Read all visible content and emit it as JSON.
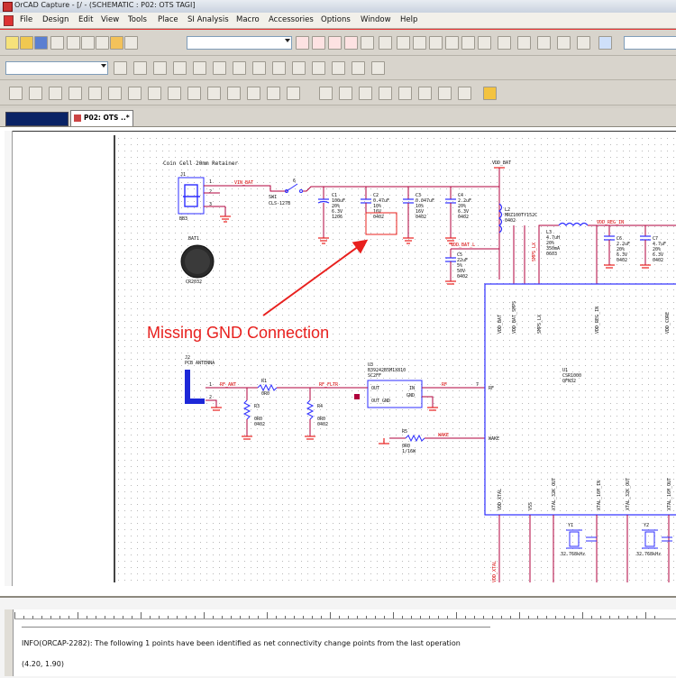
{
  "window": {
    "title": "OrCAD Capture - [/ - (SCHEMATIC : P02: OTS TAGI]"
  },
  "menu": [
    "File",
    "Design",
    "Edit",
    "View",
    "Tools",
    "Place",
    "SI Analysis",
    "Macro",
    "Accessories",
    "Options",
    "Window",
    "Help"
  ],
  "tabs": [
    {
      "label": ""
    },
    {
      "label": "P02: OTS ..*"
    }
  ],
  "annotation": {
    "text": "Missing GND Connection",
    "color": "#e8201e"
  },
  "colors": {
    "wire": "#b0003c",
    "part": "#2d2dff",
    "power": "#e8201e",
    "net_label": "#d80000"
  },
  "schematic": {
    "header": "Coin Cell 20mm Retainer",
    "vdd_bat": "VDD_BAT",
    "parts": {
      "j1_ref": "J1",
      "j1_val": "BB3",
      "bat1": "BAT1",
      "bat1_val": "CR2032",
      "sw1": "SW1",
      "sw1_val": "CLS-127B",
      "c1": [
        "C1",
        "100uF",
        "20%",
        "6.3V",
        "1206"
      ],
      "c2": [
        "C2",
        "0.47uF",
        "10%",
        "16V",
        "0402"
      ],
      "c3": [
        "C3",
        "0.047uF",
        "10%",
        "16V",
        "0402"
      ],
      "c4": [
        "C4",
        "2.2uF",
        "20%",
        "6.3V",
        "0402"
      ],
      "l2": [
        "L2",
        "MRZ100TY152C",
        "0402"
      ],
      "c5": [
        "C5",
        "22uF",
        "5%",
        "50V",
        "0402"
      ],
      "c6": [
        "C6",
        "2.2uF",
        "20%",
        "6.3V",
        "0402"
      ],
      "c7": [
        "C7",
        "4.7uF",
        "20%",
        "6.3V",
        "0402"
      ],
      "l3": [
        "L3",
        "4.7uH",
        "20%",
        "350mA",
        "0603"
      ],
      "pcb_antenna": [
        "J2",
        "PCB ANTENNA"
      ],
      "r1": [
        "R1",
        "0R0"
      ],
      "r3": [
        "R3",
        "0R0",
        "0402"
      ],
      "r4": [
        "R4",
        "0R0",
        "0402"
      ],
      "u3": [
        "U3",
        "B39242B5M1X810",
        "SC2FF",
        "OUT",
        "OUT_GND",
        "IN",
        "GND"
      ],
      "r5": [
        "R5",
        "0R0",
        "1/16W"
      ],
      "u1": [
        "U1",
        "CSR1000",
        "QFN32"
      ]
    },
    "nets": {
      "vin_bat": "VIN_BAT",
      "vdd_bat_l": "VDD_BAT_L",
      "smps_lx": "SMPS_LX",
      "vdd_reg_in": "VDD_REG_IN",
      "rf_ant": "RF_ANT",
      "rf_fltr": "RF_FLTR",
      "rf": "RF",
      "wake": "WAKE",
      "vdd_xtal": "VDD_XTAL"
    },
    "u1_pins_top": [
      "VDD_BAT",
      "VDD_BAT_SMPS",
      "SMPS_LX",
      "VDD_REG_IN",
      "VDD_CORE"
    ],
    "u1_pins_bottom": [
      "VDD_XTAL",
      "VSS",
      "XTAL_32K_OUT",
      "XTAL_16M_IN",
      "XTAL_32K_OUT",
      "XTAL_16M_OUT"
    ],
    "u1_pins_left": [
      "RF",
      "WAKE"
    ],
    "xtals": [
      [
        "Y1",
        "32.768kHz"
      ],
      [
        "Y2",
        "32.768kHz"
      ]
    ]
  },
  "session_log": {
    "lines": [
      "INFO(ORCAP-2282): The following 1 points have been identified as net connectivity change points from the last operation",
      "(4.20, 1.90)"
    ]
  }
}
